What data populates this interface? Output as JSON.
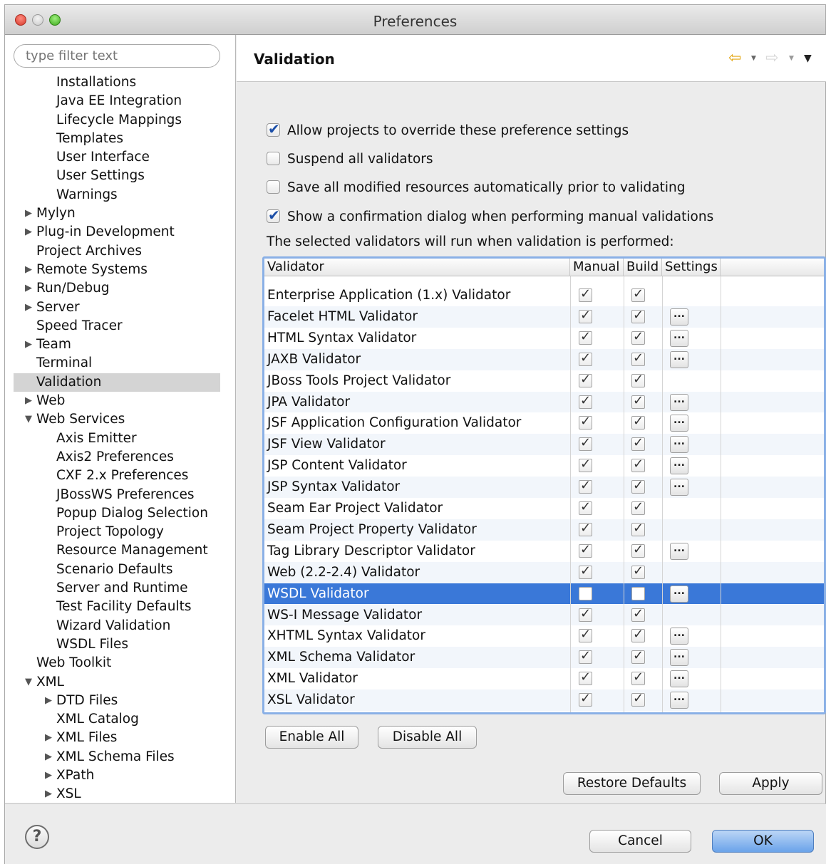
{
  "window": {
    "title": "Preferences"
  },
  "filter": {
    "placeholder": "type filter text"
  },
  "tree": [
    {
      "label": "Installations",
      "level": 1
    },
    {
      "label": "Java EE Integration",
      "level": 1
    },
    {
      "label": "Lifecycle Mappings",
      "level": 1
    },
    {
      "label": "Templates",
      "level": 1
    },
    {
      "label": "User Interface",
      "level": 1
    },
    {
      "label": "User Settings",
      "level": 1
    },
    {
      "label": "Warnings",
      "level": 1
    },
    {
      "label": "Mylyn",
      "level": 0,
      "toggle": "collapsed"
    },
    {
      "label": "Plug-in Development",
      "level": 0,
      "toggle": "collapsed"
    },
    {
      "label": "Project Archives",
      "level": 0
    },
    {
      "label": "Remote Systems",
      "level": 0,
      "toggle": "collapsed"
    },
    {
      "label": "Run/Debug",
      "level": 0,
      "toggle": "collapsed"
    },
    {
      "label": "Server",
      "level": 0,
      "toggle": "collapsed"
    },
    {
      "label": "Speed Tracer",
      "level": 0
    },
    {
      "label": "Team",
      "level": 0,
      "toggle": "collapsed"
    },
    {
      "label": "Terminal",
      "level": 0
    },
    {
      "label": "Validation",
      "level": 0,
      "selected": true
    },
    {
      "label": "Web",
      "level": 0,
      "toggle": "collapsed"
    },
    {
      "label": "Web Services",
      "level": 0,
      "toggle": "expanded"
    },
    {
      "label": "Axis Emitter",
      "level": 1
    },
    {
      "label": "Axis2 Preferences",
      "level": 1
    },
    {
      "label": "CXF 2.x Preferences",
      "level": 1
    },
    {
      "label": "JBossWS Preferences",
      "level": 1
    },
    {
      "label": "Popup Dialog Selection",
      "level": 1
    },
    {
      "label": "Project Topology",
      "level": 1
    },
    {
      "label": "Resource Management",
      "level": 1
    },
    {
      "label": "Scenario Defaults",
      "level": 1
    },
    {
      "label": "Server and Runtime",
      "level": 1
    },
    {
      "label": "Test Facility Defaults",
      "level": 1
    },
    {
      "label": "Wizard Validation",
      "level": 1
    },
    {
      "label": "WSDL Files",
      "level": 1
    },
    {
      "label": "Web Toolkit",
      "level": 0
    },
    {
      "label": "XML",
      "level": 0,
      "toggle": "expanded"
    },
    {
      "label": "DTD Files",
      "level": 1,
      "toggle": "collapsed"
    },
    {
      "label": "XML Catalog",
      "level": 1
    },
    {
      "label": "XML Files",
      "level": 1,
      "toggle": "collapsed"
    },
    {
      "label": "XML Schema Files",
      "level": 1,
      "toggle": "collapsed"
    },
    {
      "label": "XPath",
      "level": 1,
      "toggle": "collapsed"
    },
    {
      "label": "XSL",
      "level": 1,
      "toggle": "collapsed"
    }
  ],
  "page": {
    "title": "Validation",
    "options": {
      "allow_override": {
        "label": "Allow projects to override these preference settings",
        "checked": true
      },
      "suspend_all": {
        "label": "Suspend all validators",
        "checked": false
      },
      "save_all": {
        "label": "Save all modified resources automatically prior to validating",
        "checked": false
      },
      "confirm_dialog": {
        "label": "Show a confirmation dialog when performing manual validations",
        "checked": true
      }
    },
    "info_text": "The selected validators will run when validation is performed:",
    "table": {
      "columns": {
        "validator": "Validator",
        "manual": "Manual",
        "build": "Build",
        "settings": "Settings"
      },
      "rows": [
        {
          "name": "Enterprise Application (1.x) Validator",
          "manual": true,
          "build": true,
          "settings": false
        },
        {
          "name": "Facelet HTML Validator",
          "manual": true,
          "build": true,
          "settings": true
        },
        {
          "name": "HTML Syntax Validator",
          "manual": true,
          "build": true,
          "settings": true
        },
        {
          "name": "JAXB Validator",
          "manual": true,
          "build": true,
          "settings": true
        },
        {
          "name": "JBoss Tools Project Validator",
          "manual": true,
          "build": true,
          "settings": false
        },
        {
          "name": "JPA Validator",
          "manual": true,
          "build": true,
          "settings": true
        },
        {
          "name": "JSF Application Configuration Validator",
          "manual": true,
          "build": true,
          "settings": true
        },
        {
          "name": "JSF View Validator",
          "manual": true,
          "build": true,
          "settings": true
        },
        {
          "name": "JSP Content Validator",
          "manual": true,
          "build": true,
          "settings": true
        },
        {
          "name": "JSP Syntax Validator",
          "manual": true,
          "build": true,
          "settings": true
        },
        {
          "name": "Seam Ear Project Validator",
          "manual": true,
          "build": true,
          "settings": false
        },
        {
          "name": "Seam Project Property Validator",
          "manual": true,
          "build": true,
          "settings": false
        },
        {
          "name": "Tag Library Descriptor Validator",
          "manual": true,
          "build": true,
          "settings": true
        },
        {
          "name": "Web (2.2-2.4) Validator",
          "manual": true,
          "build": true,
          "settings": false
        },
        {
          "name": "WSDL Validator",
          "manual": false,
          "build": false,
          "settings": true,
          "selected": true
        },
        {
          "name": "WS-I Message Validator",
          "manual": true,
          "build": true,
          "settings": false
        },
        {
          "name": "XHTML Syntax Validator",
          "manual": true,
          "build": true,
          "settings": true
        },
        {
          "name": "XML Schema Validator",
          "manual": true,
          "build": true,
          "settings": true
        },
        {
          "name": "XML Validator",
          "manual": true,
          "build": true,
          "settings": true
        },
        {
          "name": "XSL Validator",
          "manual": true,
          "build": true,
          "settings": true
        }
      ],
      "settings_button_label": "..."
    },
    "buttons": {
      "enable_all": "Enable All",
      "disable_all": "Disable All",
      "restore_defaults": "Restore Defaults",
      "apply": "Apply"
    }
  },
  "footer": {
    "help_label": "?",
    "cancel": "Cancel",
    "ok": "OK"
  },
  "icons": {
    "back": "back-arrow-icon",
    "forward": "forward-arrow-icon",
    "menu": "view-menu-icon"
  },
  "colors": {
    "selection": "#3a78d8",
    "tree_selection": "#d4d4d4",
    "back_arrow": "#e3a715"
  }
}
